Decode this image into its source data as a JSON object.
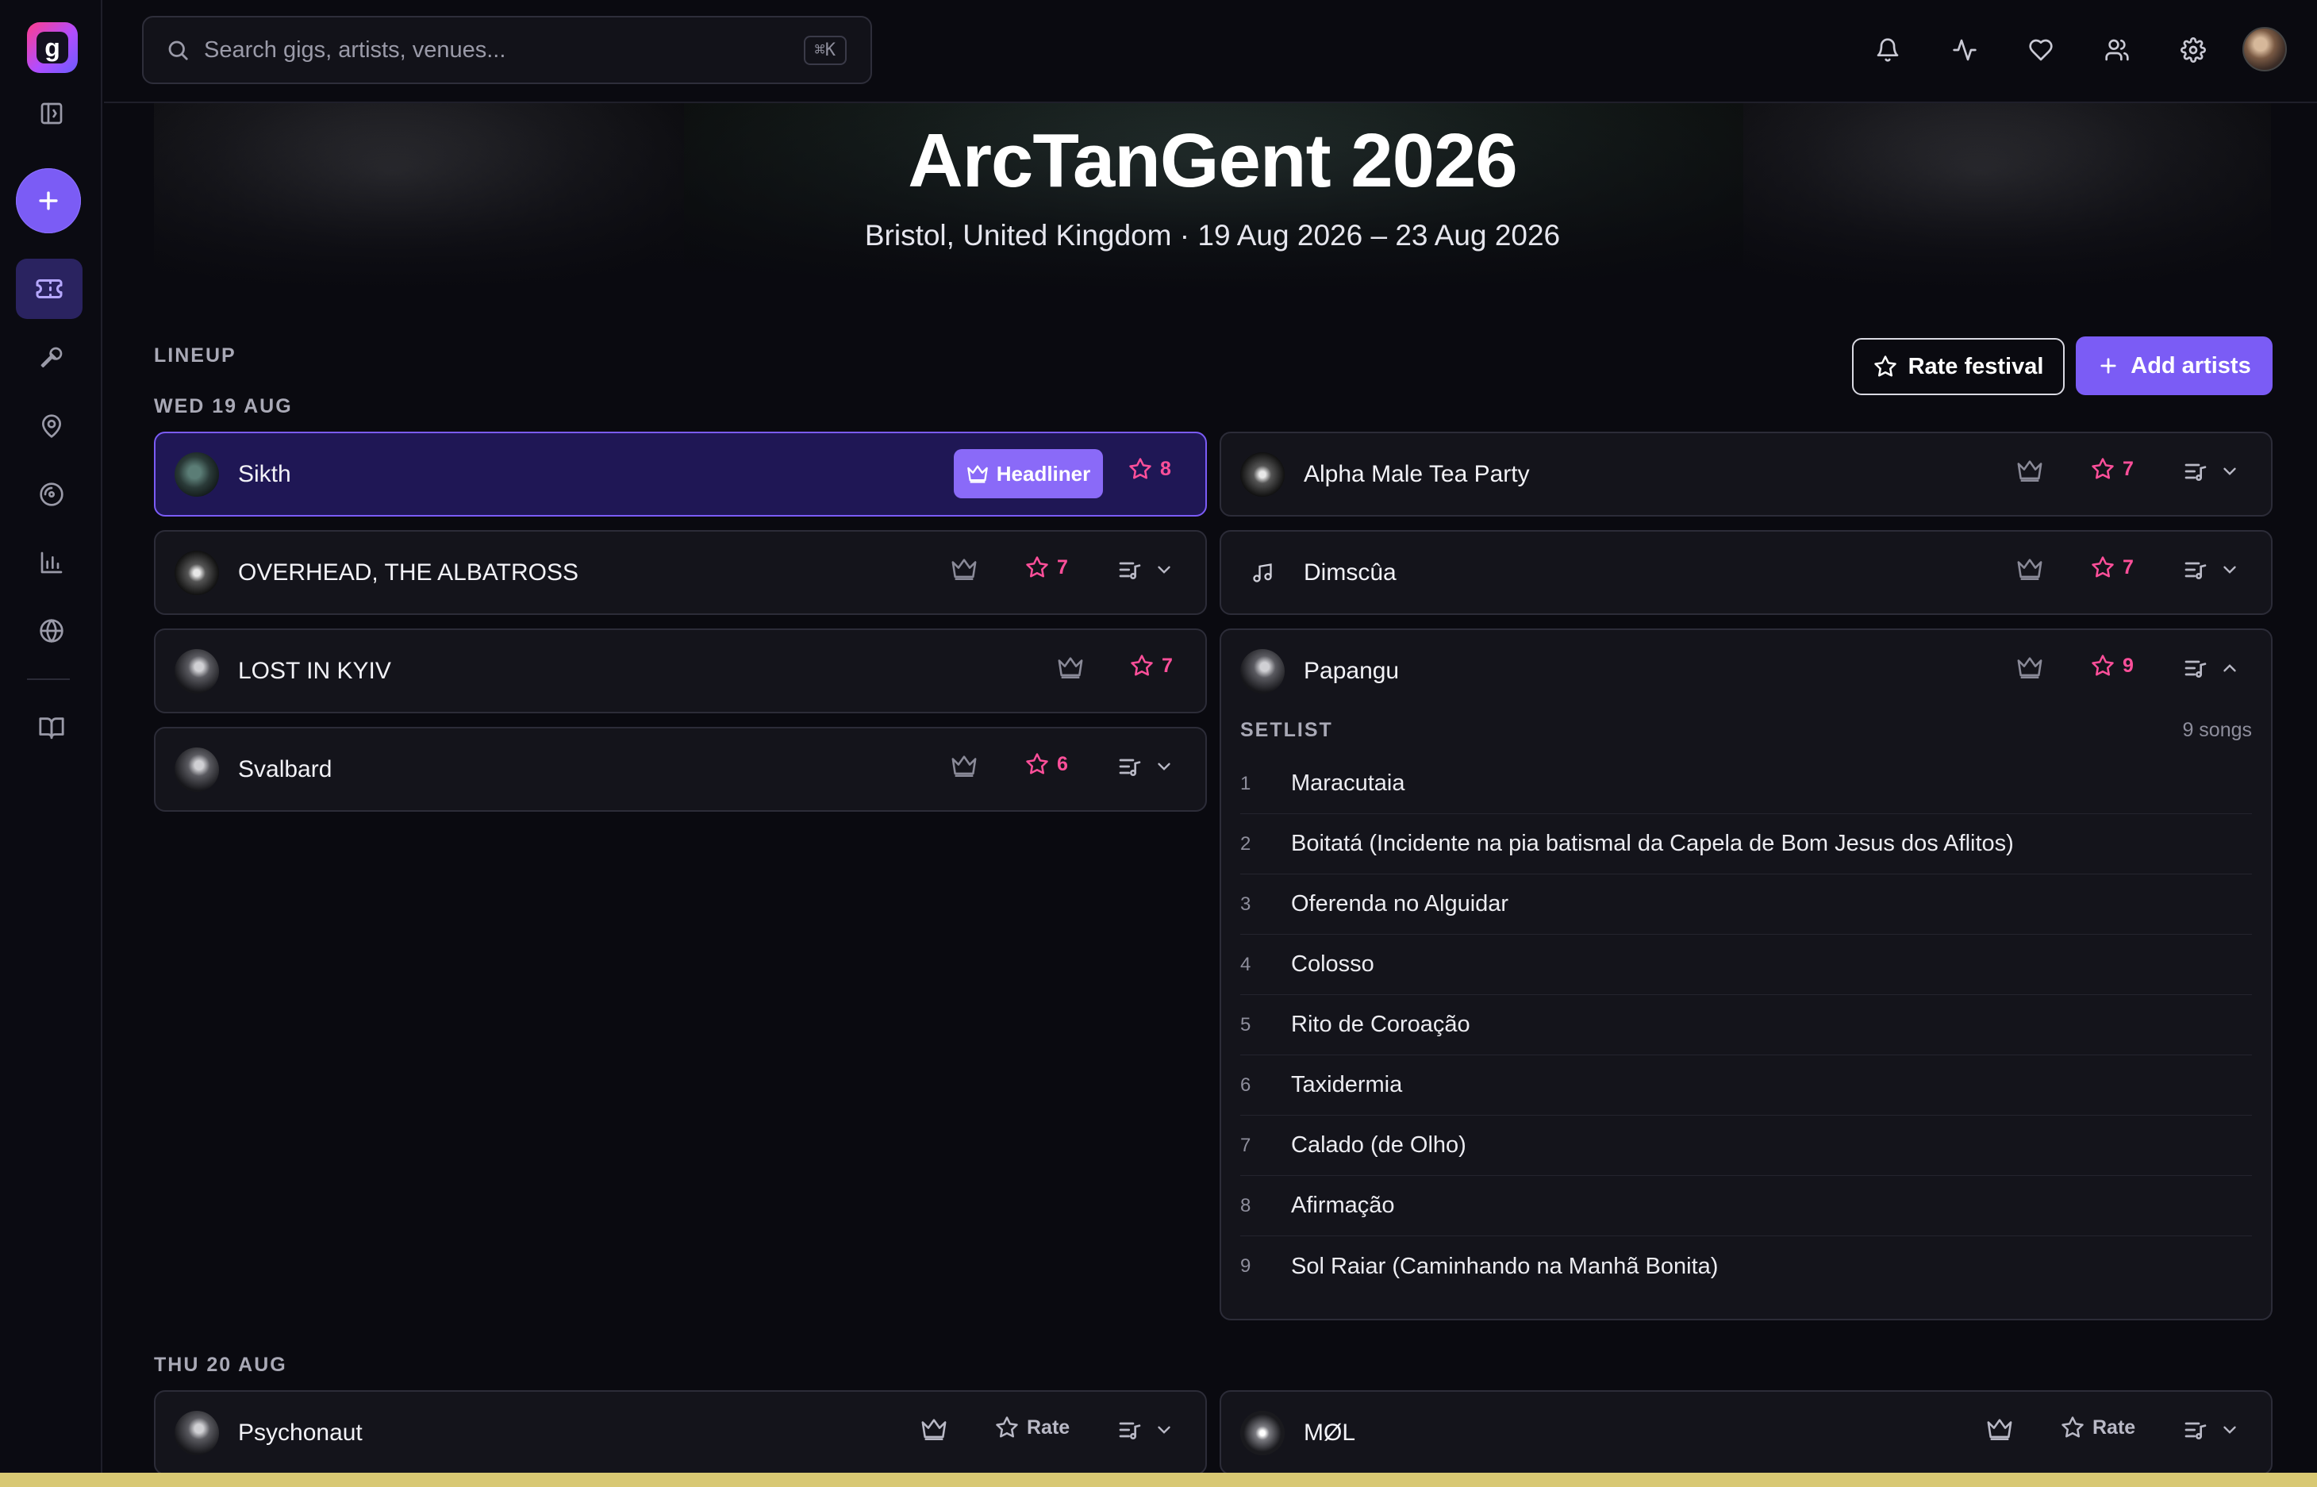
{
  "app": {
    "logo_letter": "g",
    "search_placeholder": "Search gigs, artists, venues...",
    "search_shortcut": "⌘K",
    "accent": "#7b5cf5",
    "rating_color": "#ff4f9a"
  },
  "sidebar": {
    "items": [
      {
        "icon": "sidebar-toggle-icon"
      },
      {
        "icon": "plus-icon"
      },
      {
        "icon": "ticket-icon",
        "active": true
      },
      {
        "icon": "microphone-icon"
      },
      {
        "icon": "map-pin-icon"
      },
      {
        "icon": "disc-icon"
      },
      {
        "icon": "bar-chart-icon"
      },
      {
        "icon": "globe-icon"
      },
      {
        "icon": "book-icon"
      }
    ]
  },
  "topbar": {
    "icons": [
      "bell-icon",
      "activity-icon",
      "heart-icon",
      "users-icon",
      "gear-icon"
    ]
  },
  "hero": {
    "title": "ArcTanGent 2026",
    "subtitle": "Bristol, United Kingdom · 19 Aug 2026 – 23 Aug 2026"
  },
  "lineup": {
    "section_label": "LINEUP",
    "rate_festival_label": "Rate festival",
    "add_artists_label": "Add artists",
    "days": [
      {
        "label": "WED 19 AUG",
        "artists": [
          {
            "name": "Sikth",
            "headliner": true,
            "headliner_label": "Headliner",
            "rating": "8"
          },
          {
            "name": "Alpha Male Tea Party",
            "rating": "7"
          },
          {
            "name": "OVERHEAD, THE ALBATROSS",
            "rating": "7"
          },
          {
            "name": "Dimscûa",
            "rating": "7"
          },
          {
            "name": "LOST IN KYIV",
            "rating": "7"
          },
          {
            "name": "Papangu",
            "rating": "9",
            "expanded": true
          },
          {
            "name": "Svalbard",
            "rating": "6"
          }
        ]
      },
      {
        "label": "THU 20 AUG",
        "artists": [
          {
            "name": "Psychonaut",
            "rate_label": "Rate"
          },
          {
            "name": "MØL",
            "rate_label": "Rate"
          }
        ]
      }
    ]
  },
  "setlist": {
    "heading": "SETLIST",
    "count": "9 songs",
    "songs": [
      {
        "n": "1",
        "title": "Maracutaia"
      },
      {
        "n": "2",
        "title": "Boitatá (Incidente na pia batismal da Capela de Bom Jesus dos Aflitos)"
      },
      {
        "n": "3",
        "title": "Oferenda no Alguidar"
      },
      {
        "n": "4",
        "title": "Colosso"
      },
      {
        "n": "5",
        "title": "Rito de Coroação"
      },
      {
        "n": "6",
        "title": "Taxidermia"
      },
      {
        "n": "7",
        "title": "Calado (de Olho)"
      },
      {
        "n": "8",
        "title": "Afirmação"
      },
      {
        "n": "9",
        "title": "Sol Raiar (Caminhando na Manhã Bonita)"
      }
    ]
  }
}
